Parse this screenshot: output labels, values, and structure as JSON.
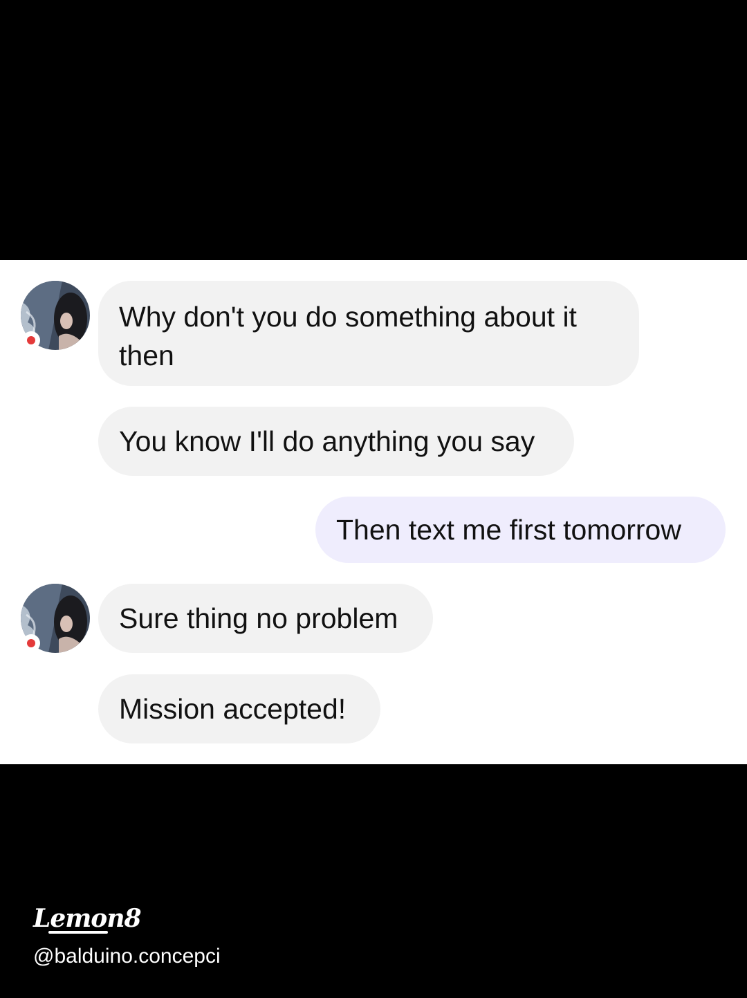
{
  "conversation": {
    "messages": [
      {
        "sender": "contact",
        "text_lines": [
          "Why don't you do something about it",
          "then"
        ]
      },
      {
        "sender": "contact",
        "text": "You know I'll do anything you say"
      },
      {
        "sender": "me",
        "text": "Then text me first tomorrow"
      },
      {
        "sender": "contact",
        "text": "Sure thing no problem"
      },
      {
        "sender": "contact",
        "text": "Mission accepted!"
      }
    ],
    "contact_avatar_icon": "profile-photo",
    "online_status_color": "#e43a3a"
  },
  "colors": {
    "incoming_bubble": "#f2f2f2",
    "outgoing_bubble": "#efedfd",
    "background": "#000000",
    "panel": "#ffffff"
  },
  "watermark": {
    "brand": "Lemon8",
    "handle": "@balduino.concepci"
  }
}
